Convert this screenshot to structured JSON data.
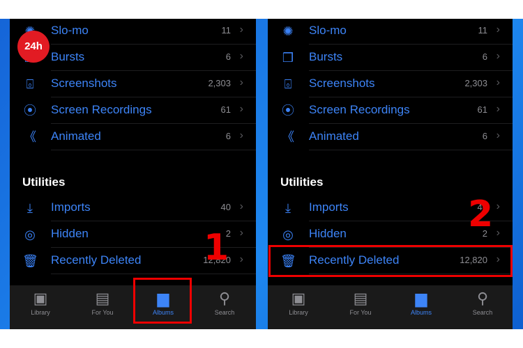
{
  "colors": {
    "accent": "#3d84f7",
    "highlight": "#e00000",
    "background": "#000000"
  },
  "panels": [
    {
      "items": [
        {
          "icon": "slomo-icon",
          "glyph": "✺",
          "label": "Slo-mo",
          "count": "11"
        },
        {
          "icon": "bursts-icon",
          "glyph": "❒",
          "label": "Bursts",
          "count": "6"
        },
        {
          "icon": "screenshot-icon",
          "glyph": "⌻",
          "label": "Screenshots",
          "count": "2,303"
        },
        {
          "icon": "screen-recording-icon",
          "glyph": "⦿",
          "label": "Screen Recordings",
          "count": "61"
        },
        {
          "icon": "animated-icon",
          "glyph": "《",
          "label": "Animated",
          "count": "6"
        }
      ],
      "section": "Utilities",
      "utilities": [
        {
          "icon": "import-icon",
          "glyph": "⤓",
          "label": "Imports",
          "count": "40"
        },
        {
          "icon": "hidden-eye-icon",
          "glyph": "◎",
          "label": "Hidden",
          "count": "2"
        },
        {
          "icon": "trash-icon",
          "glyph": "🗑",
          "label": "Recently Deleted",
          "count": "12,820"
        }
      ],
      "tabs": [
        {
          "icon": "library-icon",
          "glyph": "▣",
          "label": "Library"
        },
        {
          "icon": "for-you-icon",
          "glyph": "▤",
          "label": "For You"
        },
        {
          "icon": "albums-icon",
          "glyph": "▆",
          "label": "Albums",
          "active": true
        },
        {
          "icon": "search-icon",
          "glyph": "⚲",
          "label": "Search"
        }
      ],
      "step": "1"
    },
    {
      "items": [
        {
          "icon": "slomo-icon",
          "glyph": "✺",
          "label": "Slo-mo",
          "count": "11"
        },
        {
          "icon": "bursts-icon",
          "glyph": "❒",
          "label": "Bursts",
          "count": "6"
        },
        {
          "icon": "screenshot-icon",
          "glyph": "⌻",
          "label": "Screenshots",
          "count": "2,303"
        },
        {
          "icon": "screen-recording-icon",
          "glyph": "⦿",
          "label": "Screen Recordings",
          "count": "61"
        },
        {
          "icon": "animated-icon",
          "glyph": "《",
          "label": "Animated",
          "count": "6"
        }
      ],
      "section": "Utilities",
      "utilities": [
        {
          "icon": "import-icon",
          "glyph": "⤓",
          "label": "Imports",
          "count": "40"
        },
        {
          "icon": "hidden-eye-icon",
          "glyph": "◎",
          "label": "Hidden",
          "count": "2"
        },
        {
          "icon": "trash-icon",
          "glyph": "🗑",
          "label": "Recently Deleted",
          "count": "12,820"
        }
      ],
      "tabs": [
        {
          "icon": "library-icon",
          "glyph": "▣",
          "label": "Library"
        },
        {
          "icon": "for-you-icon",
          "glyph": "▤",
          "label": "For You"
        },
        {
          "icon": "albums-icon",
          "glyph": "▆",
          "label": "Albums",
          "active": true
        },
        {
          "icon": "search-icon",
          "glyph": "⚲",
          "label": "Search"
        }
      ],
      "step": "2"
    }
  ],
  "chevron": "›",
  "watermark": "24h"
}
